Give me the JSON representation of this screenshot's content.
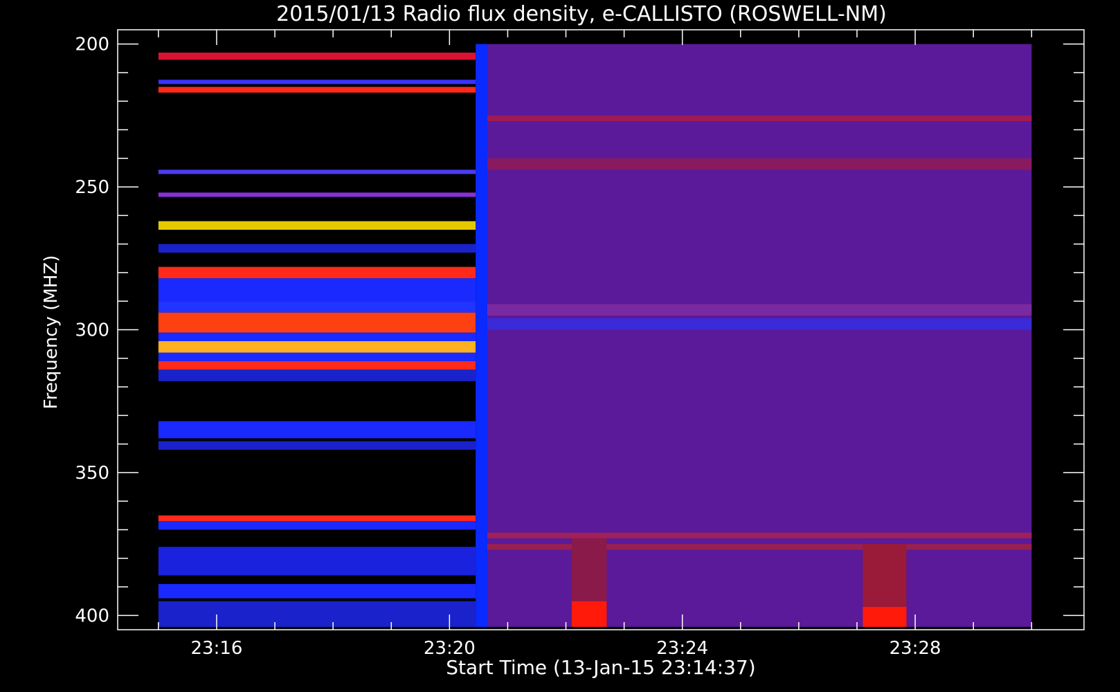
{
  "chart_data": {
    "type": "heatmap",
    "title": "2015/01/13  Radio flux density, e-CALLISTO (ROSWELL-NM)",
    "xlabel": "Start Time (13-Jan-15 23:14:37)",
    "ylabel": "Frequency (MHZ)",
    "x_tick_labels": [
      "23:16",
      "23:20",
      "23:24",
      "23:28"
    ],
    "y_tick_labels": [
      "200",
      "250",
      "300",
      "350",
      "400"
    ],
    "x_unit": "minutes of day",
    "x_ticks": [
      1396,
      1400,
      1404,
      1408
    ],
    "xlim": [
      1394.3,
      1410.9
    ],
    "y_ticks": [
      200,
      250,
      300,
      350,
      400
    ],
    "ylim": [
      195,
      405
    ],
    "y_inverted": true,
    "data_time_range": [
      1395.0,
      1410.0
    ],
    "data_freq_range": [
      200,
      404
    ],
    "segments": [
      {
        "time_range": [
          1395.0,
          1400.45
        ],
        "background": "#000000",
        "bands": [
          {
            "freq": [
              203,
              205.5
            ],
            "color": "#dd1133"
          },
          {
            "freq": [
              212.5,
              214
            ],
            "color": "#3a32ff"
          },
          {
            "freq": [
              215,
              217
            ],
            "color": "#ff2a1a"
          },
          {
            "freq": [
              244,
              245.5
            ],
            "color": "#4a3cf0"
          },
          {
            "freq": [
              252,
              253.5
            ],
            "color": "#8830d8"
          },
          {
            "freq": [
              262,
              265
            ],
            "color": "#e6c800"
          },
          {
            "freq": [
              270,
              273
            ],
            "color": "#1a22cc"
          },
          {
            "freq": [
              278,
              282
            ],
            "color": "#ff2a1a"
          },
          {
            "freq": [
              282,
              290
            ],
            "color": "#1a2aff"
          },
          {
            "freq": [
              290,
              294
            ],
            "color": "#2234ff"
          },
          {
            "freq": [
              294,
              301
            ],
            "color": "#ff4010"
          },
          {
            "freq": [
              301,
              304
            ],
            "color": "#1a2aff"
          },
          {
            "freq": [
              304,
              308
            ],
            "color": "#ffb020"
          },
          {
            "freq": [
              308,
              311
            ],
            "color": "#1a2aff"
          },
          {
            "freq": [
              311,
              314
            ],
            "color": "#ff2a1a"
          },
          {
            "freq": [
              314,
              318
            ],
            "color": "#1a22cc"
          },
          {
            "freq": [
              332,
              338
            ],
            "color": "#1a2aff"
          },
          {
            "freq": [
              339,
              342
            ],
            "color": "#1a22cc"
          },
          {
            "freq": [
              365,
              367
            ],
            "color": "#ff2a1a"
          },
          {
            "freq": [
              367,
              370
            ],
            "color": "#1a2aff"
          },
          {
            "freq": [
              376,
              386
            ],
            "color": "#1a22dd"
          },
          {
            "freq": [
              389,
              394
            ],
            "color": "#1a2aff"
          },
          {
            "freq": [
              395,
              404
            ],
            "color": "#1a22cc"
          }
        ]
      },
      {
        "time_range": [
          1400.45,
          1400.65
        ],
        "background": "#0a2aff",
        "bands": []
      },
      {
        "time_range": [
          1400.65,
          1410.0
        ],
        "background": "#5a1a9a",
        "bands": [
          {
            "freq": [
              225,
              227
            ],
            "color": "#a01a55"
          },
          {
            "freq": [
              240,
              244
            ],
            "color": "#8a1a60"
          },
          {
            "freq": [
              291,
              295
            ],
            "color": "#7a2aa0"
          },
          {
            "freq": [
              296,
              300
            ],
            "color": "#3a2ad8"
          },
          {
            "freq": [
              371,
              373
            ],
            "color": "#a0205a"
          },
          {
            "freq": [
              375,
              377
            ],
            "color": "#9a2050"
          }
        ]
      }
    ],
    "bursts": [
      {
        "time_range": [
          1402.1,
          1402.7
        ],
        "freq": [
          395,
          404
        ],
        "color": "#ff1a0a"
      },
      {
        "time_range": [
          1402.1,
          1402.7
        ],
        "freq": [
          373,
          395
        ],
        "color": "#8a1a4a"
      },
      {
        "time_range": [
          1407.1,
          1407.85
        ],
        "freq": [
          397,
          404
        ],
        "color": "#ff1a0a"
      },
      {
        "time_range": [
          1407.1,
          1407.85
        ],
        "freq": [
          375,
          397
        ],
        "color": "#9a1a3a"
      }
    ]
  }
}
